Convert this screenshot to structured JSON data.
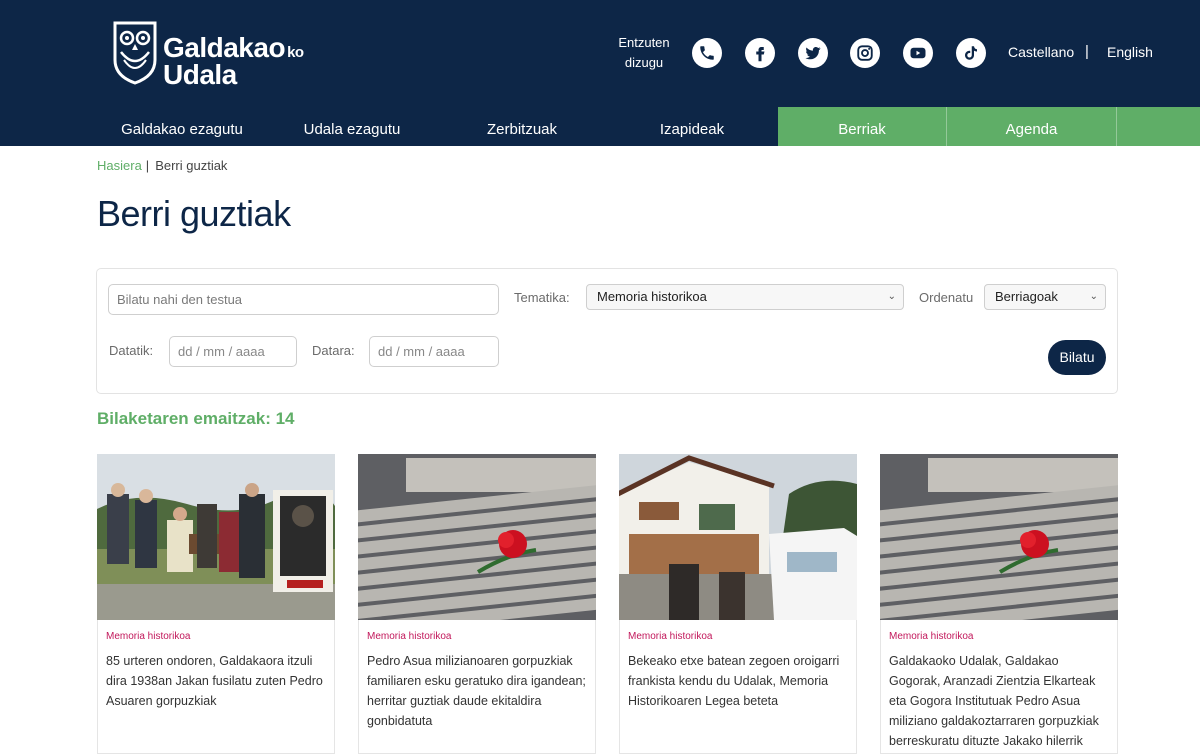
{
  "header": {
    "logo_line1": "Galdakao",
    "logo_suffix": "ko",
    "logo_line2": "Udala",
    "listen_line1": "Entzuten",
    "listen_line2": "dizugu",
    "social_icons": [
      "phone-icon",
      "facebook-icon",
      "twitter-icon",
      "instagram-icon",
      "youtube-icon",
      "tiktok-icon"
    ],
    "lang_es": "Castellano",
    "lang_sep": "|",
    "lang_en": "English"
  },
  "nav": {
    "items": [
      {
        "label": "Galdakao ezagutu"
      },
      {
        "label": "Udala ezagutu"
      },
      {
        "label": "Zerbitzuak"
      },
      {
        "label": "Izapideak"
      },
      {
        "label": "Berriak"
      },
      {
        "label": "Agenda"
      }
    ]
  },
  "breadcrumb": {
    "home": "Hasiera",
    "sep": "|",
    "current": "Berri guztiak"
  },
  "page_title": "Berri guztiak",
  "filter": {
    "search_placeholder": "Bilatu nahi den testua",
    "topic_label": "Tematika:",
    "topic_value": "Memoria historikoa",
    "order_label": "Ordenatu",
    "order_value": "Berriagoak",
    "from_label": "Datatik:",
    "from_placeholder": "dd / mm / aaaa",
    "to_label": "Datara:",
    "to_placeholder": "dd / mm / aaaa",
    "search_button": "Bilatu"
  },
  "results_text": "Bilaketaren emaitzak: 14",
  "cards": [
    {
      "tag": "Memoria historikoa",
      "title": "85 urteren ondoren, Galdakaora itzuli dira 1938an Jakan fusilatu zuten Pedro Asuaren gorpuzkiak"
    },
    {
      "tag": "Memoria historikoa",
      "title": "Pedro Asua milizianoaren gorpuzkiak familiaren esku geratuko dira igandean; herritar guztiak daude ekitaldira gonbidatuta"
    },
    {
      "tag": "Memoria historikoa",
      "title": "Bekeako etxe batean zegoen oroigarri frankista kendu du Udalak, Memoria Historikoaren Legea beteta"
    },
    {
      "tag": "Memoria historikoa",
      "title": "Galdakaoko Udalak, Galdakao Gogorak, Aranzadi Zientzia Elkarteak eta Gogora Institutuak Pedro Asua miliziano galdakoztarraren gorpuzkiak berreskuratu dituzte Jakako hilerrik"
    }
  ],
  "colors": {
    "navy": "#0d2647",
    "green": "#5fae67",
    "tag": "#c2185b"
  }
}
